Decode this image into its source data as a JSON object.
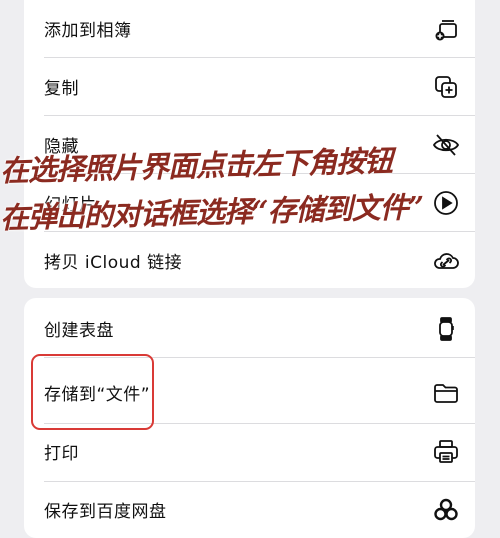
{
  "group1": {
    "items": [
      {
        "label": "添加到相簿",
        "icon": "add-to-album-icon"
      },
      {
        "label": "复制",
        "icon": "copy-icon"
      },
      {
        "label": "隐藏",
        "icon": "eye-slash-icon"
      },
      {
        "label": "幻灯片",
        "icon": "play-circle-icon"
      },
      {
        "label": "拷贝 iCloud 链接",
        "icon": "cloud-link-icon"
      }
    ]
  },
  "group2": {
    "items": [
      {
        "label": "创建表盘",
        "icon": "watch-icon"
      },
      {
        "label": "存储到“文件”",
        "icon": "folder-icon"
      },
      {
        "label": "打印",
        "icon": "printer-icon"
      },
      {
        "label": "保存到百度网盘",
        "icon": "baidu-netdisk-icon"
      }
    ]
  },
  "annotation": {
    "line1": "在选择照片界面点击左下角按钮",
    "line2": "在弹出的对话框选择“存储到文件”"
  },
  "colors": {
    "background": "#eeeef1",
    "card": "#ffffff",
    "highlight": "#d93a36",
    "annotation_text": "#8b2a20"
  }
}
